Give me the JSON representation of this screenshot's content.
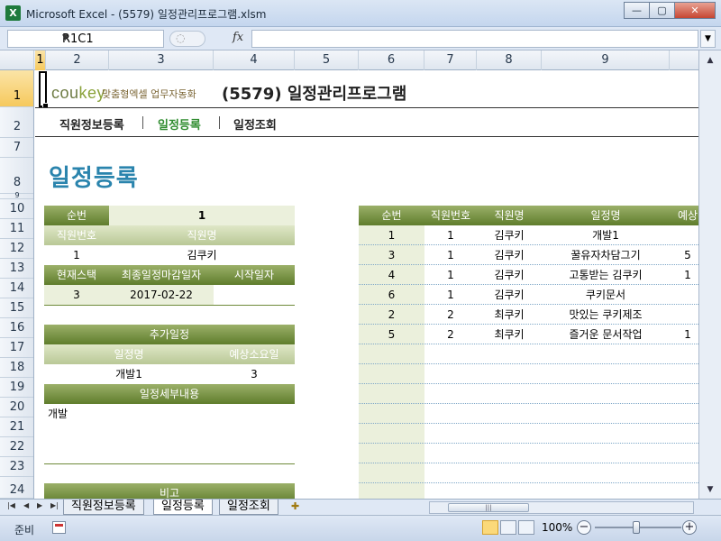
{
  "window": {
    "app_icon": "X",
    "title": "Microsoft Excel - (5579) 일정관리프로그램.xlsm",
    "minimize": "—",
    "maximize": "▢",
    "close": "✕"
  },
  "formula_bar": {
    "name_box": "R1C1",
    "fx_label": "fx",
    "value": ""
  },
  "columns": [
    "1",
    "2",
    "3",
    "4",
    "5",
    "6",
    "7",
    "8",
    "9"
  ],
  "rows": [
    "1",
    "2",
    "7",
    "8",
    "9",
    "10",
    "11",
    "12",
    "13",
    "14",
    "15",
    "16",
    "17",
    "18",
    "19",
    "20",
    "21",
    "22",
    "23",
    "24"
  ],
  "header": {
    "logo_main": "cou",
    "logo_accent": "key",
    "logo_sub": "맞춤형엑셀 업무자동화",
    "page_title": "(5579) 일정관리프로그램"
  },
  "nav": {
    "items": [
      "직원정보등록",
      "일정등록",
      "일정조회"
    ],
    "active": "일정등록"
  },
  "section_title": "일정등록",
  "form": {
    "seq_label": "순번",
    "seq_value": "1",
    "emp_no_label": "직원번호",
    "emp_name_label": "직원명",
    "emp_no_value": "1",
    "emp_name_value": "김쿠키",
    "stack_label": "현재스택",
    "deadline_label": "최종일정마감일자",
    "start_label": "시작일자",
    "stack_value": "3",
    "deadline_value": "2017-02-22",
    "start_value": "",
    "add_schedule_label": "추가일정",
    "schedule_name_label": "일정명",
    "expected_days_label": "예상소요일",
    "schedule_name_value": "개발1",
    "expected_days_value": "3",
    "detail_label": "일정세부내용",
    "detail_value": "개발",
    "remarks_label": "비고"
  },
  "list": {
    "headers": [
      "순번",
      "직원번호",
      "직원명",
      "일정명",
      "예상"
    ],
    "rows": [
      {
        "seq": "1",
        "emp_no": "1",
        "name": "김쿠키",
        "schedule": "개발1",
        "days": ""
      },
      {
        "seq": "3",
        "emp_no": "1",
        "name": "김쿠키",
        "schedule": "꿀유자차담그기",
        "days": "5"
      },
      {
        "seq": "4",
        "emp_no": "1",
        "name": "김쿠키",
        "schedule": "고통받는 김쿠키",
        "days": "1"
      },
      {
        "seq": "6",
        "emp_no": "1",
        "name": "김쿠키",
        "schedule": "쿠키문서",
        "days": ""
      },
      {
        "seq": "2",
        "emp_no": "2",
        "name": "최쿠키",
        "schedule": "맛있는 쿠키제조",
        "days": ""
      },
      {
        "seq": "5",
        "emp_no": "2",
        "name": "최쿠키",
        "schedule": "즐거운 문서작업",
        "days": "1"
      }
    ]
  },
  "sheet_tabs": [
    "직원정보등록",
    "일정등록",
    "일정조회"
  ],
  "active_sheet": "일정등록",
  "status": {
    "mode": "준비",
    "zoom": "100%"
  }
}
